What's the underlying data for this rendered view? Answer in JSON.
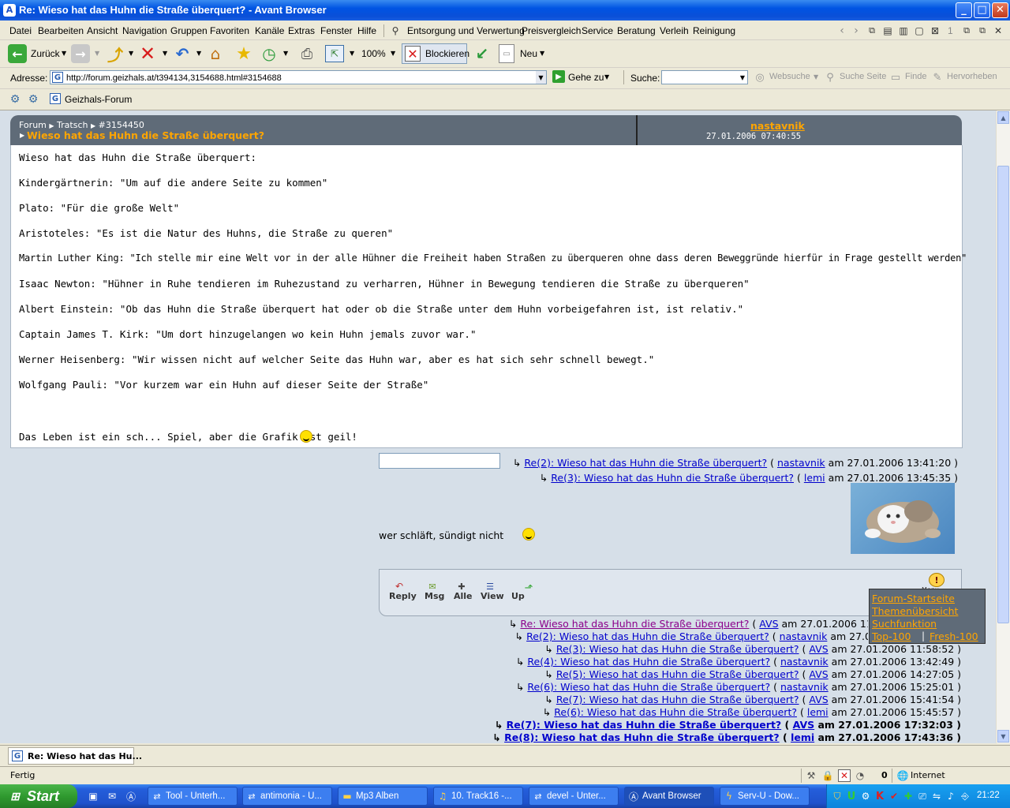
{
  "window": {
    "title": "Re: Wieso hat das Huhn die Straße überquert? - Avant Browser",
    "controls": {
      "minimize": "_",
      "maximize": "□",
      "close": "✕"
    }
  },
  "menubar": {
    "items": [
      "Datei",
      "Bearbeiten",
      "Ansicht",
      "Navigation",
      "Gruppen",
      "Favoriten",
      "Kanäle",
      "Extras",
      "Fenster",
      "Hilfe"
    ],
    "links": [
      "Entsorgung und Verwertung",
      "Preisvergleich",
      "Service",
      "Beratung",
      "Verleih",
      "Reinigung"
    ],
    "page_counter": "1"
  },
  "toolbar": {
    "back": "Zurück",
    "zoom": "100%",
    "block": "Blockieren",
    "new": "Neu"
  },
  "address": {
    "label": "Adresse:",
    "url": "http://forum.geizhals.at/t394134,3154688.html#3154688",
    "go": "Gehe zu",
    "search_label": "Suche:",
    "websearch": "Websuche",
    "search_page": "Suche Seite",
    "find": "Finde",
    "highlight": "Hervorheben"
  },
  "links_bar": {
    "site": "Geizhals-Forum"
  },
  "post": {
    "breadcrumb": [
      "Forum",
      "Tratsch",
      "#3154450"
    ],
    "title": "Wieso hat das Huhn die Straße überquert?",
    "author": "nastavnik",
    "date": "27.01.2006 07:40:55",
    "lines": [
      "Wieso hat das Huhn die Straße überquert:",
      "Kindergärtnerin: \"Um auf die andere Seite zu kommen\"",
      "Plato: \"Für die große Welt\"",
      "Aristoteles: \"Es ist die Natur des Huhns, die Straße zu queren\"",
      "Martin Luther King: \"Ich stelle mir eine Welt vor in der alle Hühner die Freiheit haben Straßen zu überqueren ohne dass deren Beweggründe hierfür in Frage gestellt werden\"",
      "Isaac Newton: \"Hühner in Ruhe tendieren im Ruhezustand zu verharren, Hühner in Bewegung tendieren die Straße zu überqueren\"",
      "Albert Einstein: \"Ob das Huhn die Straße überquert hat oder ob die Straße unter dem Huhn vorbeigefahren ist, ist relativ.\"",
      "Captain James T. Kirk: \"Um dort hinzugelangen wo kein Huhn jemals zuvor war.\"",
      "Werner Heisenberg: \"Wir wissen nicht auf welcher Seite das Huhn war, aber es hat sich sehr schnell bewegt.\"",
      "Wolfgang Pauli: \"Vor kurzem war ein Huhn auf dieser Seite der Straße\""
    ],
    "signature": "Das Leben ist ein sch... Spiel, aber die Grafik ist geil!"
  },
  "replies_top": [
    {
      "arrow": "↳",
      "subject": "Re(2): Wieso hat das Huhn die Straße überquert?",
      "open": "(",
      "author": "nastavnik",
      "meta": "am 27.01.2006 13:41:20 )"
    },
    {
      "arrow": "↳",
      "subject": "Re(3): Wieso hat das Huhn die Straße überquert?",
      "open": "(",
      "author": "lemi",
      "meta": "am 27.01.2006 13:45:35 )"
    }
  ],
  "current_reply": {
    "text": "wer schläft, sündigt nicht"
  },
  "post_actions": {
    "reply": "Reply",
    "msg": "Msg",
    "all": "Alle",
    "view": "View",
    "up": "Up"
  },
  "menu_popup": {
    "label": "Menu",
    "items": [
      "Forum-Startseite",
      "Themenübersicht",
      "Suchfunktion"
    ],
    "top": "Top-100",
    "sep": "|",
    "fresh": "Fresh-100"
  },
  "replies_bottom": [
    {
      "arrow": "↳",
      "subject": "Re: Wieso hat das Huhn die Straße überquert?",
      "open": "(",
      "author": "AVS",
      "meta": "am 27.01.2006 11:",
      "visited": true
    },
    {
      "arrow": "↳",
      "subject": "Re(2): Wieso hat das Huhn die Straße überquert?",
      "open": "(",
      "author": "nastavnik",
      "meta": "am 27.0"
    },
    {
      "arrow": "↳",
      "subject": "Re(3): Wieso hat das Huhn die Straße überquert?",
      "open": "(",
      "author": "AVS",
      "meta": "am 27.01.2006 11:58:52 )"
    },
    {
      "arrow": "↳",
      "subject": "Re(4): Wieso hat das Huhn die Straße überquert?",
      "open": "(",
      "author": "nastavnik",
      "meta": "am 27.01.2006 13:42:49 )"
    },
    {
      "arrow": "↳",
      "subject": "Re(5): Wieso hat das Huhn die Straße überquert?",
      "open": "(",
      "author": "AVS",
      "meta": "am 27.01.2006 14:27:05 )"
    },
    {
      "arrow": "↳",
      "subject": "Re(6): Wieso hat das Huhn die Straße überquert?",
      "open": "(",
      "author": "nastavnik",
      "meta": "am 27.01.2006 15:25:01 )"
    },
    {
      "arrow": "↳",
      "subject": "Re(7): Wieso hat das Huhn die Straße überquert?",
      "open": "(",
      "author": "AVS",
      "meta": "am 27.01.2006 15:41:54 )"
    },
    {
      "arrow": "↳",
      "subject": "Re(6): Wieso hat das Huhn die Straße überquert?",
      "open": "(",
      "author": "lemi",
      "meta": "am 27.01.2006 15:45:57 )"
    },
    {
      "arrow": "↳",
      "subject": "Re(7): Wieso hat das Huhn die Straße überquert?",
      "open": "(",
      "author": "AVS",
      "meta": "am 27.01.2006 17:32:03 )",
      "bold": true
    },
    {
      "arrow": "↳",
      "subject": "Re(8): Wieso hat das Huhn die Straße überquert?",
      "open": "(",
      "author": "lemi",
      "meta": "am 27.01.2006 17:43:36 )",
      "bold": true
    }
  ],
  "tab": {
    "title": "Re: Wieso hat das Hu..."
  },
  "status": {
    "text": "Fertig",
    "count": "0",
    "zone": "Internet"
  },
  "taskbar": {
    "start": "Start",
    "tasks": [
      "Tool - Unterh...",
      "antimonia - U...",
      "Mp3 Alben",
      "10. Track16 -...",
      "devel - Unter...",
      "Avant Browser",
      "Serv-U - Dow..."
    ],
    "clock": "21:22"
  }
}
